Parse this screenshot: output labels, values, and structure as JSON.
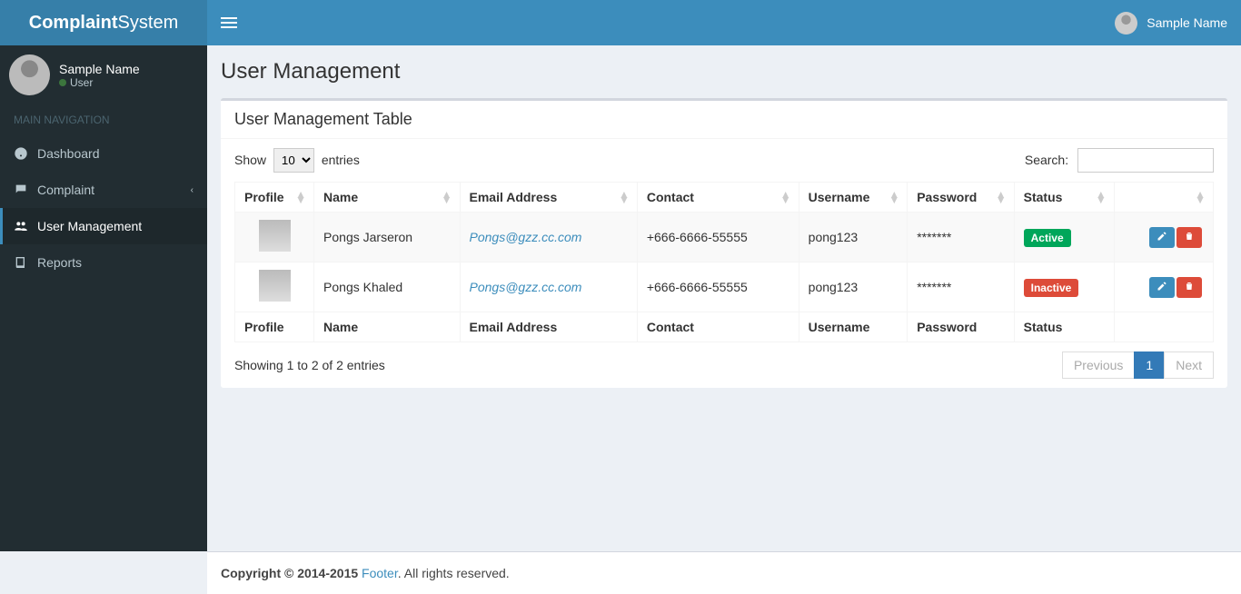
{
  "brand": {
    "bold": "Complaint",
    "rest": "System"
  },
  "topbar": {
    "username": "Sample Name"
  },
  "sidebar": {
    "user": {
      "name": "Sample Name",
      "role": "User"
    },
    "header": "MAIN NAVIGATION",
    "items": [
      {
        "label": "Dashboard"
      },
      {
        "label": "Complaint"
      },
      {
        "label": "User Management"
      },
      {
        "label": "Reports"
      }
    ]
  },
  "page": {
    "title": "User Management",
    "box_title": "User Management Table"
  },
  "datatable": {
    "length_pre": "Show",
    "length_val": "10",
    "length_post": "entries",
    "search_label": "Search:",
    "columns": [
      "Profile",
      "Name",
      "Email Address",
      "Contact",
      "Username",
      "Password",
      "Status",
      ""
    ],
    "rows": [
      {
        "name": "Pongs Jarseron",
        "email": "Pongs@gzz.cc.com",
        "contact": "+666-6666-55555",
        "username": "pong123",
        "password": "*******",
        "status": "Active",
        "status_class": "green"
      },
      {
        "name": "Pongs Khaled",
        "email": "Pongs@gzz.cc.com",
        "contact": "+666-6666-55555",
        "username": "pong123",
        "password": "*******",
        "status": "Inactive",
        "status_class": "red"
      }
    ],
    "info": "Showing 1 to 2 of 2 entries",
    "pagination": {
      "prev": "Previous",
      "page": "1",
      "next": "Next"
    }
  },
  "footer": {
    "copyright_bold": "Copyright © 2014-2015 ",
    "link": "Footer",
    "rest": ". All rights reserved."
  }
}
